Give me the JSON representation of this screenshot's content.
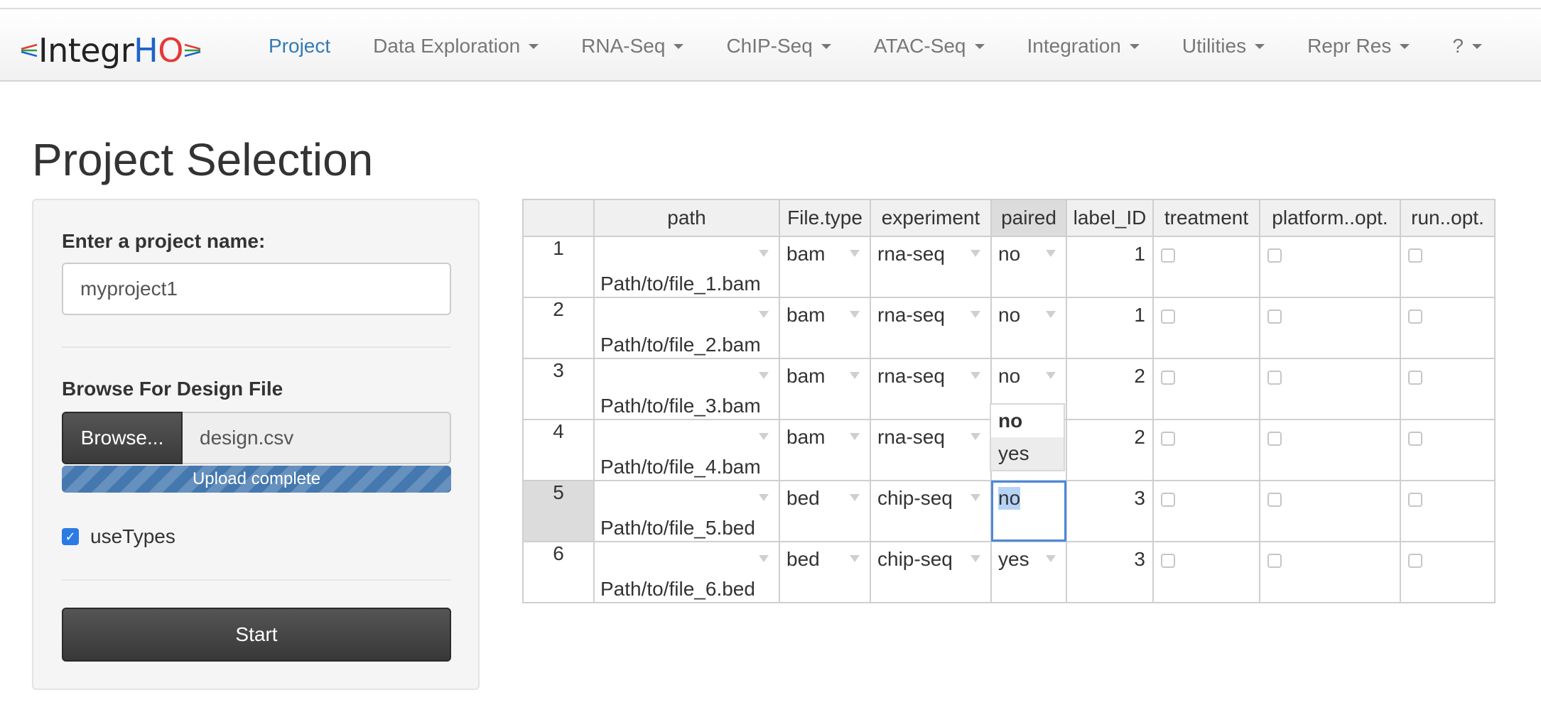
{
  "navbar": {
    "brand": {
      "prefix": "Integr",
      "h": "H",
      "o": "O"
    },
    "items": [
      {
        "label": "Project",
        "active": true,
        "dropdown": false
      },
      {
        "label": "Data Exploration",
        "dropdown": true
      },
      {
        "label": "RNA-Seq",
        "dropdown": true
      },
      {
        "label": "ChIP-Seq",
        "dropdown": true
      },
      {
        "label": "ATAC-Seq",
        "dropdown": true
      },
      {
        "label": "Integration",
        "dropdown": true
      },
      {
        "label": "Utilities",
        "dropdown": true
      },
      {
        "label": "Repr Res",
        "dropdown": true
      },
      {
        "label": "?",
        "dropdown": true
      }
    ]
  },
  "page": {
    "title": "Project Selection"
  },
  "sidebar": {
    "project_label": "Enter a project name:",
    "project_value": "myproject1",
    "browse_label": "Browse For Design File",
    "browse_button": "Browse...",
    "file_name": "design.csv",
    "upload_status": "Upload complete",
    "upload_progress": 1.0,
    "use_types_label": "useTypes",
    "use_types_checked": true,
    "start_button": "Start"
  },
  "table": {
    "headers": [
      "path",
      "File.type",
      "experiment",
      "paired",
      "label_ID",
      "treatment",
      "platform..opt.",
      "run..opt."
    ],
    "rows": [
      {
        "n": "1",
        "path": "Path/to/file_1.bam",
        "file_type": "bam",
        "experiment": "rna-seq",
        "paired": "no",
        "label_id": "1"
      },
      {
        "n": "2",
        "path": "Path/to/file_2.bam",
        "file_type": "bam",
        "experiment": "rna-seq",
        "paired": "no",
        "label_id": "1"
      },
      {
        "n": "3",
        "path": "Path/to/file_3.bam",
        "file_type": "bam",
        "experiment": "rna-seq",
        "paired": "no",
        "label_id": "2"
      },
      {
        "n": "4",
        "path": "Path/to/file_4.bam",
        "file_type": "bam",
        "experiment": "rna-seq",
        "paired": "",
        "label_id": "2"
      },
      {
        "n": "5",
        "path": "Path/to/file_5.bed",
        "file_type": "bed",
        "experiment": "chip-seq",
        "paired": "no",
        "label_id": "3"
      },
      {
        "n": "6",
        "path": "Path/to/file_6.bed",
        "file_type": "bed",
        "experiment": "chip-seq",
        "paired": "yes",
        "label_id": "3"
      }
    ],
    "paired_dropdown": {
      "options": [
        "no",
        "yes"
      ],
      "selected": "no",
      "hovered": "yes"
    }
  },
  "colors": {
    "accent": "#337ab7",
    "progress": "#4478ae",
    "selection": "#4b89dc"
  }
}
